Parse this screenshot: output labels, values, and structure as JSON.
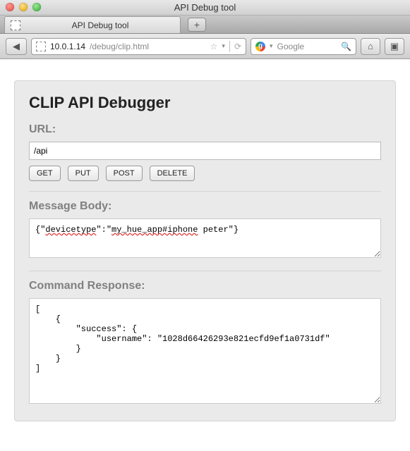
{
  "window": {
    "title": "API Debug tool"
  },
  "tab": {
    "title": "API Debug tool"
  },
  "addressbar": {
    "host": "10.0.1.14",
    "path": "/debug/clip.html"
  },
  "search": {
    "engine": "Google"
  },
  "debugger": {
    "heading": "CLIP API Debugger",
    "url_label": "URL:",
    "url_value": "/api",
    "buttons": {
      "get": "GET",
      "put": "PUT",
      "post": "POST",
      "delete": "DELETE"
    },
    "body_label": "Message Body:",
    "body_parts": {
      "p1": "{\"",
      "p2": "devicetype",
      "p3": "\":\"",
      "p4": "my_hue_app#iphone",
      "p5": " peter\"}"
    },
    "response_label": "Command Response:",
    "response_value": "[\n    {\n        \"success\": {\n            \"username\": \"1028d66426293e821ecfd9ef1a0731df\"\n        }\n    }\n]"
  }
}
